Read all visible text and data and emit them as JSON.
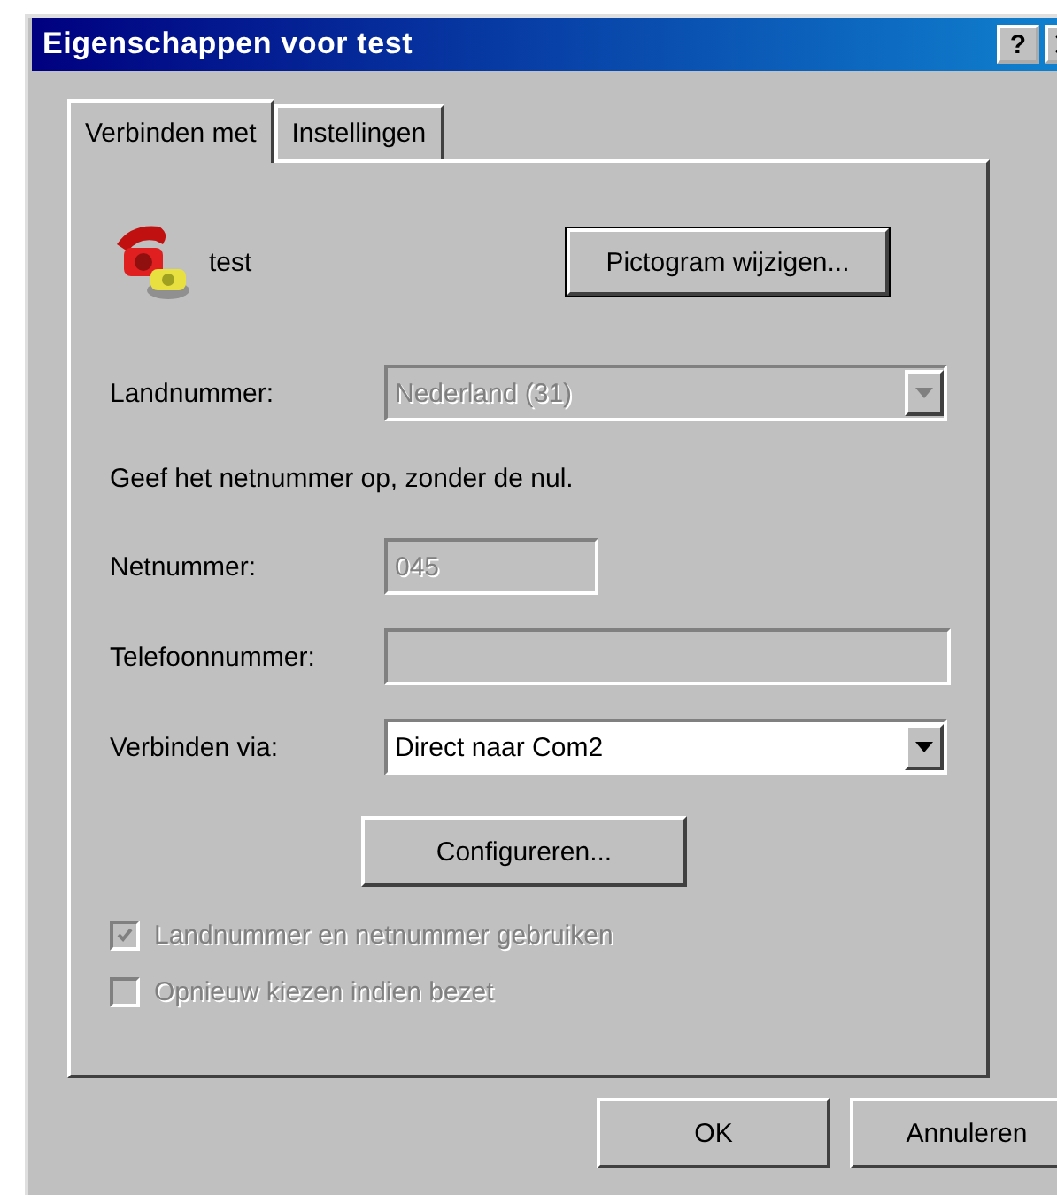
{
  "window": {
    "title": "Eigenschappen voor test",
    "help_button": "?"
  },
  "tabs": [
    {
      "label": "Verbinden met",
      "selected": true
    },
    {
      "label": "Instellingen",
      "selected": false
    }
  ],
  "connection": {
    "name": "test",
    "change_icon_button": "Pictogram wijzigen..."
  },
  "fields": [
    {
      "kind": "combo",
      "label": "Landnummer:",
      "value": "Nederland (31)",
      "disabled": true
    },
    {
      "kind": "note",
      "text": "Geef het netnummer op, zonder de nul."
    },
    {
      "kind": "short_text",
      "label": "Netnummer:",
      "value": "045",
      "disabled": true
    },
    {
      "kind": "text",
      "label": "Telefoonnummer:",
      "disabled": true
    },
    {
      "kind": "combo",
      "label": "Verbinden via:",
      "value": "Direct naar Com2",
      "disabled": false
    },
    {
      "kind": "button",
      "label": "Configureren..."
    }
  ],
  "checkboxes": [
    {
      "label": "Landnummer en netnummer gebruiken",
      "checked": true,
      "disabled": true
    },
    {
      "label": "Opnieuw kiezen indien bezet",
      "checked": false,
      "disabled": true
    }
  ],
  "buttons": [
    {
      "label": "OK"
    },
    {
      "label": "Annuleren"
    }
  ]
}
